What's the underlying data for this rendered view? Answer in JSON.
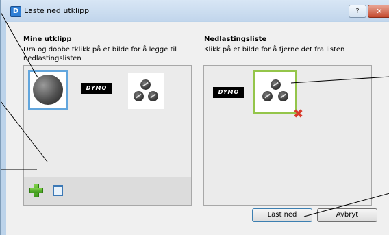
{
  "window": {
    "title": "Laste ned utklipp",
    "help_label": "?",
    "close_label": "✕"
  },
  "left_panel": {
    "heading": "Mine utklipp",
    "description_line1": "Dra og dobbeltklikk på et bilde for å legge til",
    "description_line2": "nedlastingslisten",
    "items": [
      "globe",
      "DYMO",
      "reels"
    ]
  },
  "right_panel": {
    "heading": "Nedlastingsliste",
    "description": "Klikk på et bilde for å fjerne det fra listen",
    "items": [
      "DYMO",
      "reels"
    ]
  },
  "buttons": {
    "download": "Last ned",
    "cancel": "Avbryt"
  },
  "icons": {
    "add": "plus-icon",
    "delete": "trash-icon",
    "remove": "remove-x-icon"
  },
  "colors": {
    "selection_left": "#62a6dd",
    "selection_right": "#94c54a",
    "remove_mark": "#d83a2a",
    "close_button": "#c44a2e"
  }
}
